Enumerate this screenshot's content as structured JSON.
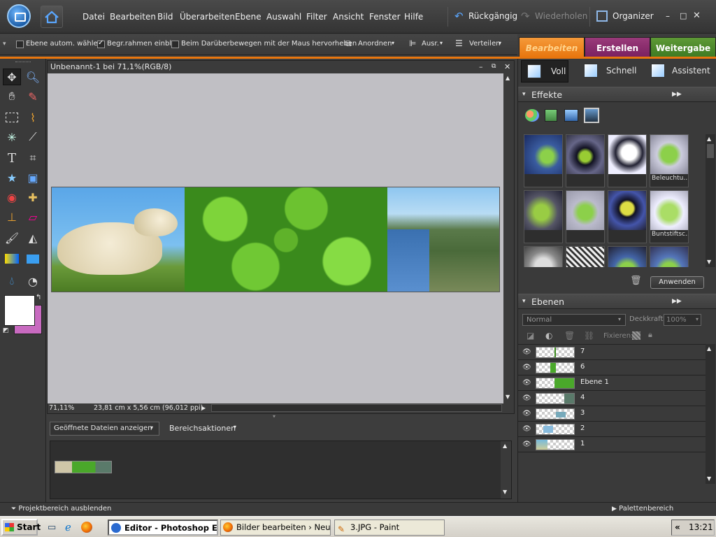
{
  "menubar": {
    "items": [
      "Datei",
      "Bearbeiten",
      "Bild",
      "Überarbeiten",
      "Ebene",
      "Auswahl",
      "Filter",
      "Ansicht",
      "Fenster",
      "Hilfe"
    ],
    "undo": "Rückgängig",
    "redo": "Wiederholen",
    "organizer": "Organizer"
  },
  "options": {
    "auto_select": "Ebene autom. wählen",
    "bounding_box": "Begr.rahmen einbl.",
    "hover_highlight": "Beim Darüberbewegen mit der Maus hervorheben",
    "arrange": "Anordnen",
    "align": "Ausr.",
    "distribute": "Verteilen",
    "auto_select_checked": false,
    "bounding_box_checked": true,
    "hover_highlight_checked": false
  },
  "modes": {
    "edit": "Bearbeiten",
    "create": "Erstellen",
    "share": "Weitergabe"
  },
  "document": {
    "title": "Unbenannt-1 bei 71,1%(RGB/8)",
    "zoom": "71,11%",
    "size_info": "23,81 cm x 5,56 cm (96,012 ppi)"
  },
  "project": {
    "dropdown": "Geöffnete Dateien anzeigen",
    "actions": "Bereichsaktionen",
    "toggle": "Projektbereich ausblenden"
  },
  "palette": {
    "toggle": "Palettenbereich"
  },
  "edit_modes": {
    "full": "Voll",
    "quick": "Schnell",
    "guided": "Assistent"
  },
  "effects": {
    "title": "Effekte",
    "thumbs": [
      "",
      "",
      "",
      "Beleuchtu...",
      "",
      "",
      "",
      "Buntstiftsc...",
      "",
      "",
      "",
      ""
    ],
    "apply": "Anwenden"
  },
  "layers": {
    "title": "Ebenen",
    "blend_mode": "Normal",
    "opacity_label": "Deckkraft:",
    "opacity_value": "100%",
    "lock_label": "Fixieren:",
    "items": [
      "7",
      "6",
      "Ebene 1",
      "4",
      "3",
      "2",
      "1"
    ]
  },
  "taskbar": {
    "start": "Start",
    "tasks": [
      "Editor - Photoshop Ele...",
      "Bilder bearbeiten › Neue...",
      "3.JPG - Paint"
    ],
    "clock": "13:21"
  },
  "colors": {
    "accent": "#e8760e",
    "edit_tab": "#e8760e",
    "create_tab": "#8a2a6a",
    "share_tab": "#4f8a2c",
    "background_swatch": "#c86ac0"
  }
}
